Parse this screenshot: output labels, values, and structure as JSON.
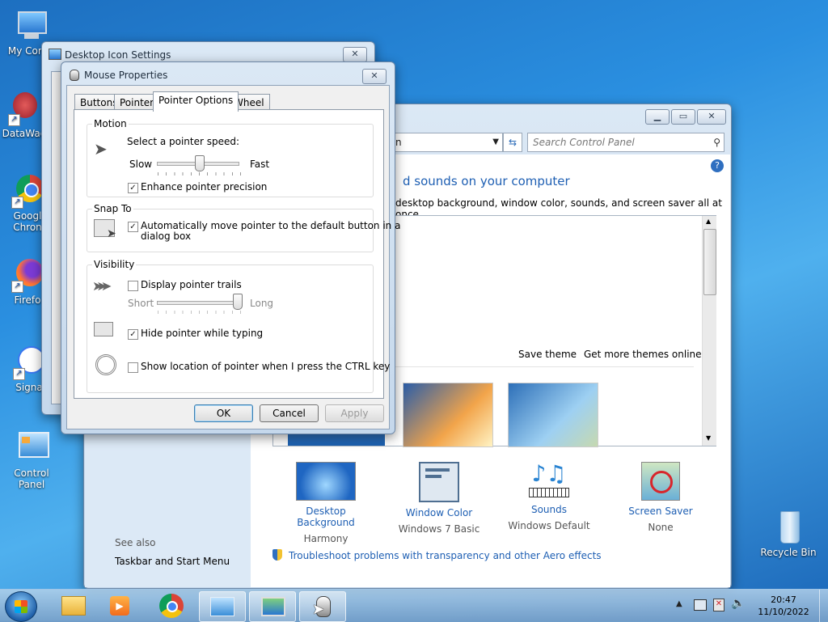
{
  "desktop": {
    "icons": [
      {
        "label": "My Comp"
      },
      {
        "label": "DataWag"
      },
      {
        "label_l1": "Googl",
        "label_l2": "Chron"
      },
      {
        "label": "Firefo"
      },
      {
        "label": "Signa"
      },
      {
        "label": "Control Panel"
      },
      {
        "label": "Recycle Bin"
      }
    ]
  },
  "desktop_icon_settings": {
    "title": "Desktop Icon Settings",
    "close": "✕"
  },
  "control_panel": {
    "address_suffix": "n",
    "search_placeholder": "Search Control Panel",
    "heading_partial": "d sounds on your computer",
    "subtitle_partial": "desktop background, window color, sounds, and screen saver all at once.",
    "save_theme": "Save theme",
    "get_more_themes": "Get more themes online",
    "bottom_items": [
      {
        "label": "Desktop Background",
        "value": "Harmony"
      },
      {
        "label": "Window Color",
        "value": "Windows 7 Basic"
      },
      {
        "label": "Sounds",
        "value": "Windows Default"
      },
      {
        "label": "Screen Saver",
        "value": "None"
      }
    ],
    "see_also": "See also",
    "taskbar_link": "Taskbar and Start Menu",
    "troubleshoot": "Troubleshoot problems with transparency and other Aero effects"
  },
  "mouse_properties": {
    "title": "Mouse Properties",
    "tabs": [
      "Buttons",
      "Pointers",
      "Pointer Options",
      "Wheel"
    ],
    "motion": {
      "label": "Motion",
      "speed_label": "Select a pointer speed:",
      "slow": "Slow",
      "fast": "Fast",
      "speed_fraction": 0.5,
      "enhance": "Enhance pointer precision",
      "enhance_checked": true
    },
    "snap_to": {
      "label": "Snap To",
      "auto_l1": "Automatically move pointer to the default button in a",
      "auto_l2": "dialog box",
      "auto_checked": true
    },
    "visibility": {
      "label": "Visibility",
      "trails": "Display pointer trails",
      "trails_checked": false,
      "short": "Short",
      "long": "Long",
      "trail_fraction": 1.0,
      "hide": "Hide pointer while typing",
      "hide_checked": true,
      "show_location": "Show location of pointer when I press the CTRL key",
      "show_checked": false
    },
    "buttons": {
      "ok": "OK",
      "cancel": "Cancel",
      "apply": "Apply"
    }
  },
  "taskbar": {
    "time": "20:47",
    "date": "11/10/2022"
  }
}
